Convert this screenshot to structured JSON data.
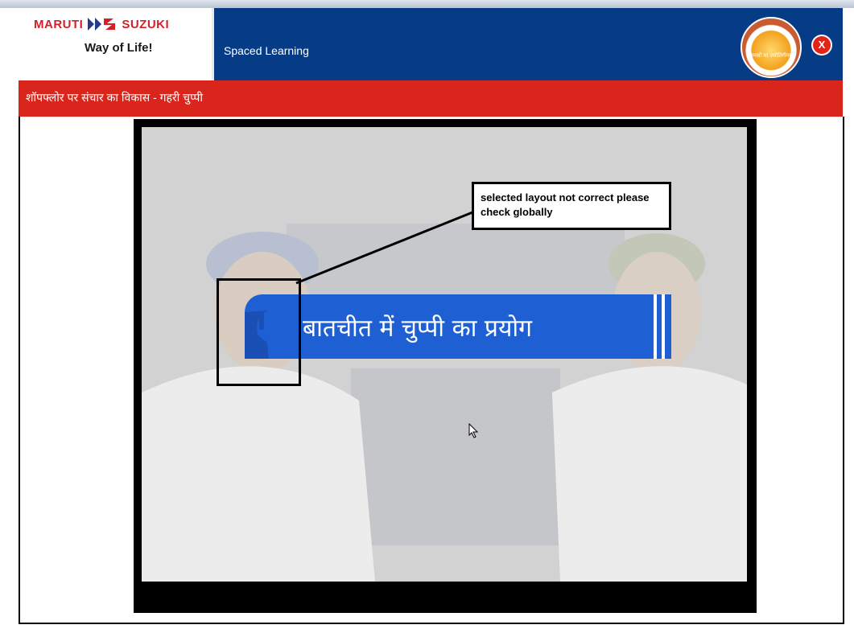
{
  "header": {
    "brand_left": "MARUTI",
    "brand_right": "SUZUKI",
    "tagline": "Way of Life!",
    "app_title": "Spaced Learning",
    "seal_text": "तमसो मा ज्योतिर्गमय",
    "close_label": "X"
  },
  "lesson": {
    "title": "शॉपफ्लोर पर संचार का विकास - गहरी चुप्पी"
  },
  "video": {
    "banner_text": "बातचीत में चुप्पी का प्रयोग"
  },
  "annotation": {
    "text": "selected layout not correct please check globally"
  },
  "colors": {
    "header_blue": "#063c86",
    "title_red": "#d9251c",
    "banner_blue": "#1f5fd4",
    "brand_red": "#d51f28"
  }
}
